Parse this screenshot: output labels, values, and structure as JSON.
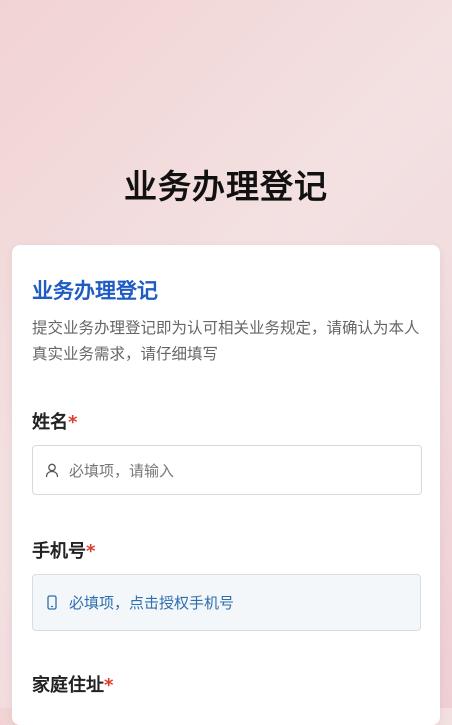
{
  "header": {
    "title": "业务办理登记"
  },
  "card": {
    "title": "业务办理登记",
    "description": "提交业务办理登记即为认可相关业务规定，请确认为本人真实业务需求，请仔细填写"
  },
  "fields": {
    "name": {
      "label": "姓名",
      "required_mark": "*",
      "placeholder": "必填项，请输入",
      "icon": "user-icon"
    },
    "phone": {
      "label": "手机号",
      "required_mark": "*",
      "placeholder": "必填项，点击授权手机号",
      "icon": "phone-icon"
    },
    "address": {
      "label": "家庭住址",
      "required_mark": "*"
    }
  },
  "colors": {
    "accent": "#1e5cc4",
    "required": "#e0392d",
    "phone_text": "#2e6fae"
  }
}
